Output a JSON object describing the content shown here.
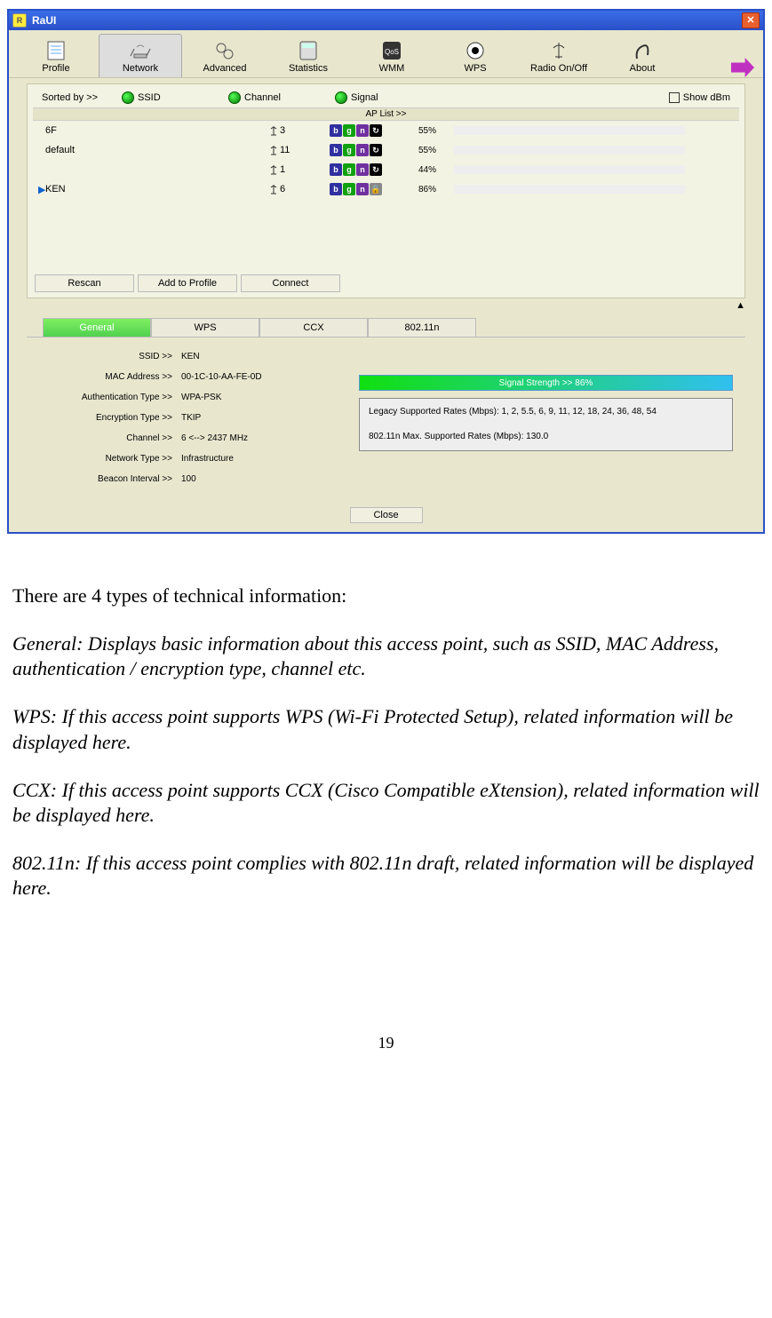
{
  "window": {
    "title": "RaUI"
  },
  "toolbar": {
    "items": [
      "Profile",
      "Network",
      "Advanced",
      "Statistics",
      "WMM",
      "WPS",
      "Radio On/Off",
      "About"
    ],
    "selected": 1
  },
  "sort": {
    "label": "Sorted by >>",
    "ssid": "SSID",
    "channel": "Channel",
    "signal": "Signal",
    "dbm": "Show dBm"
  },
  "ap_list_label": "AP List >>",
  "ap": [
    {
      "name": "6F",
      "ch": "3",
      "pct": "55%",
      "sig": 55,
      "lock": false,
      "sel": false
    },
    {
      "name": "default",
      "ch": "11",
      "pct": "55%",
      "sig": 55,
      "lock": false,
      "sel": false
    },
    {
      "name": "",
      "ch": "1",
      "pct": "44%",
      "sig": 44,
      "lock": false,
      "sel": false
    },
    {
      "name": "KEN",
      "ch": "6",
      "pct": "86%",
      "sig": 86,
      "lock": true,
      "sel": true
    }
  ],
  "buttons": {
    "rescan": "Rescan",
    "add": "Add to Profile",
    "connect": "Connect"
  },
  "tabs": [
    "General",
    "WPS",
    "CCX",
    "802.11n"
  ],
  "active_tab": 0,
  "detail": {
    "ssid_k": "SSID >>",
    "ssid_v": "KEN",
    "mac_k": "MAC Address >>",
    "mac_v": "00-1C-10-AA-FE-0D",
    "auth_k": "Authentication Type >>",
    "auth_v": "WPA-PSK",
    "enc_k": "Encryption Type >>",
    "enc_v": "TKIP",
    "ch_k": "Channel >>",
    "ch_v": "6 <--> 2437 MHz",
    "net_k": "Network Type >>",
    "net_v": "Infrastructure",
    "bi_k": "Beacon Interval >>",
    "bi_v": "100"
  },
  "signal_strength": "Signal Strength >> 86%",
  "rates": {
    "line1": "Legacy Supported Rates (Mbps): 1, 2, 5.5, 6, 9, 11, 12, 18, 24, 36, 48, 54",
    "line2": "802.11n Max. Supported Rates (Mbps): 130.0"
  },
  "close_label": "Close",
  "doc": {
    "intro": "There are 4 types of technical information:",
    "general": "General: Displays basic information about this access point, such as SSID, MAC Address, authentication / encryption type, channel etc.",
    "wps": "WPS: If this access point supports WPS (Wi-Fi Protected Setup), related information will be displayed here.",
    "ccx": "CCX: If this access point supports CCX (Cisco Compatible eXtension), related information will be displayed here.",
    "n": "802.11n: If this access point complies with 802.11n draft, related information will be displayed here."
  },
  "page_number": "19"
}
